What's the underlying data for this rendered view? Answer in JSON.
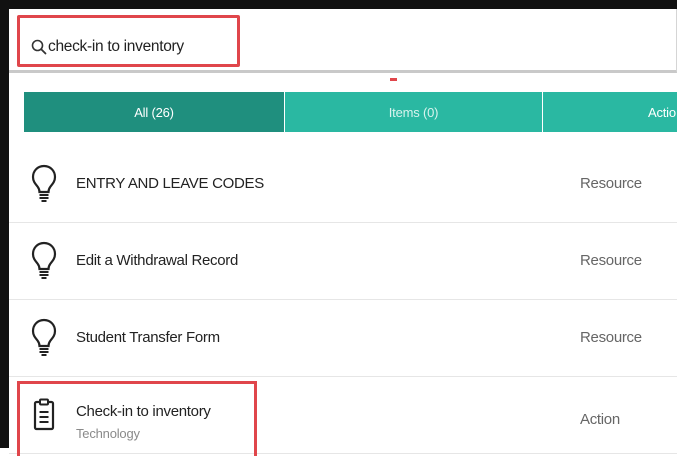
{
  "search": {
    "value": "check-in to inventory"
  },
  "tabs": [
    {
      "label": "All (26)"
    },
    {
      "label": "Items (0)"
    },
    {
      "label": "Actio"
    }
  ],
  "results": [
    {
      "title": "ENTRY AND LEAVE CODES",
      "type": "Resource",
      "icon": "lightbulb-icon"
    },
    {
      "title": "Edit a Withdrawal Record",
      "type": "Resource",
      "icon": "lightbulb-icon"
    },
    {
      "title": "Student Transfer Form",
      "type": "Resource",
      "icon": "lightbulb-icon"
    },
    {
      "title": "Check-in to inventory",
      "subtitle": "Technology",
      "type": "Action",
      "icon": "clipboard-icon"
    }
  ],
  "colors": {
    "highlight": "#e0464b",
    "tab_active": "#1f8f7e",
    "tab_inactive": "#2ab8a2"
  }
}
